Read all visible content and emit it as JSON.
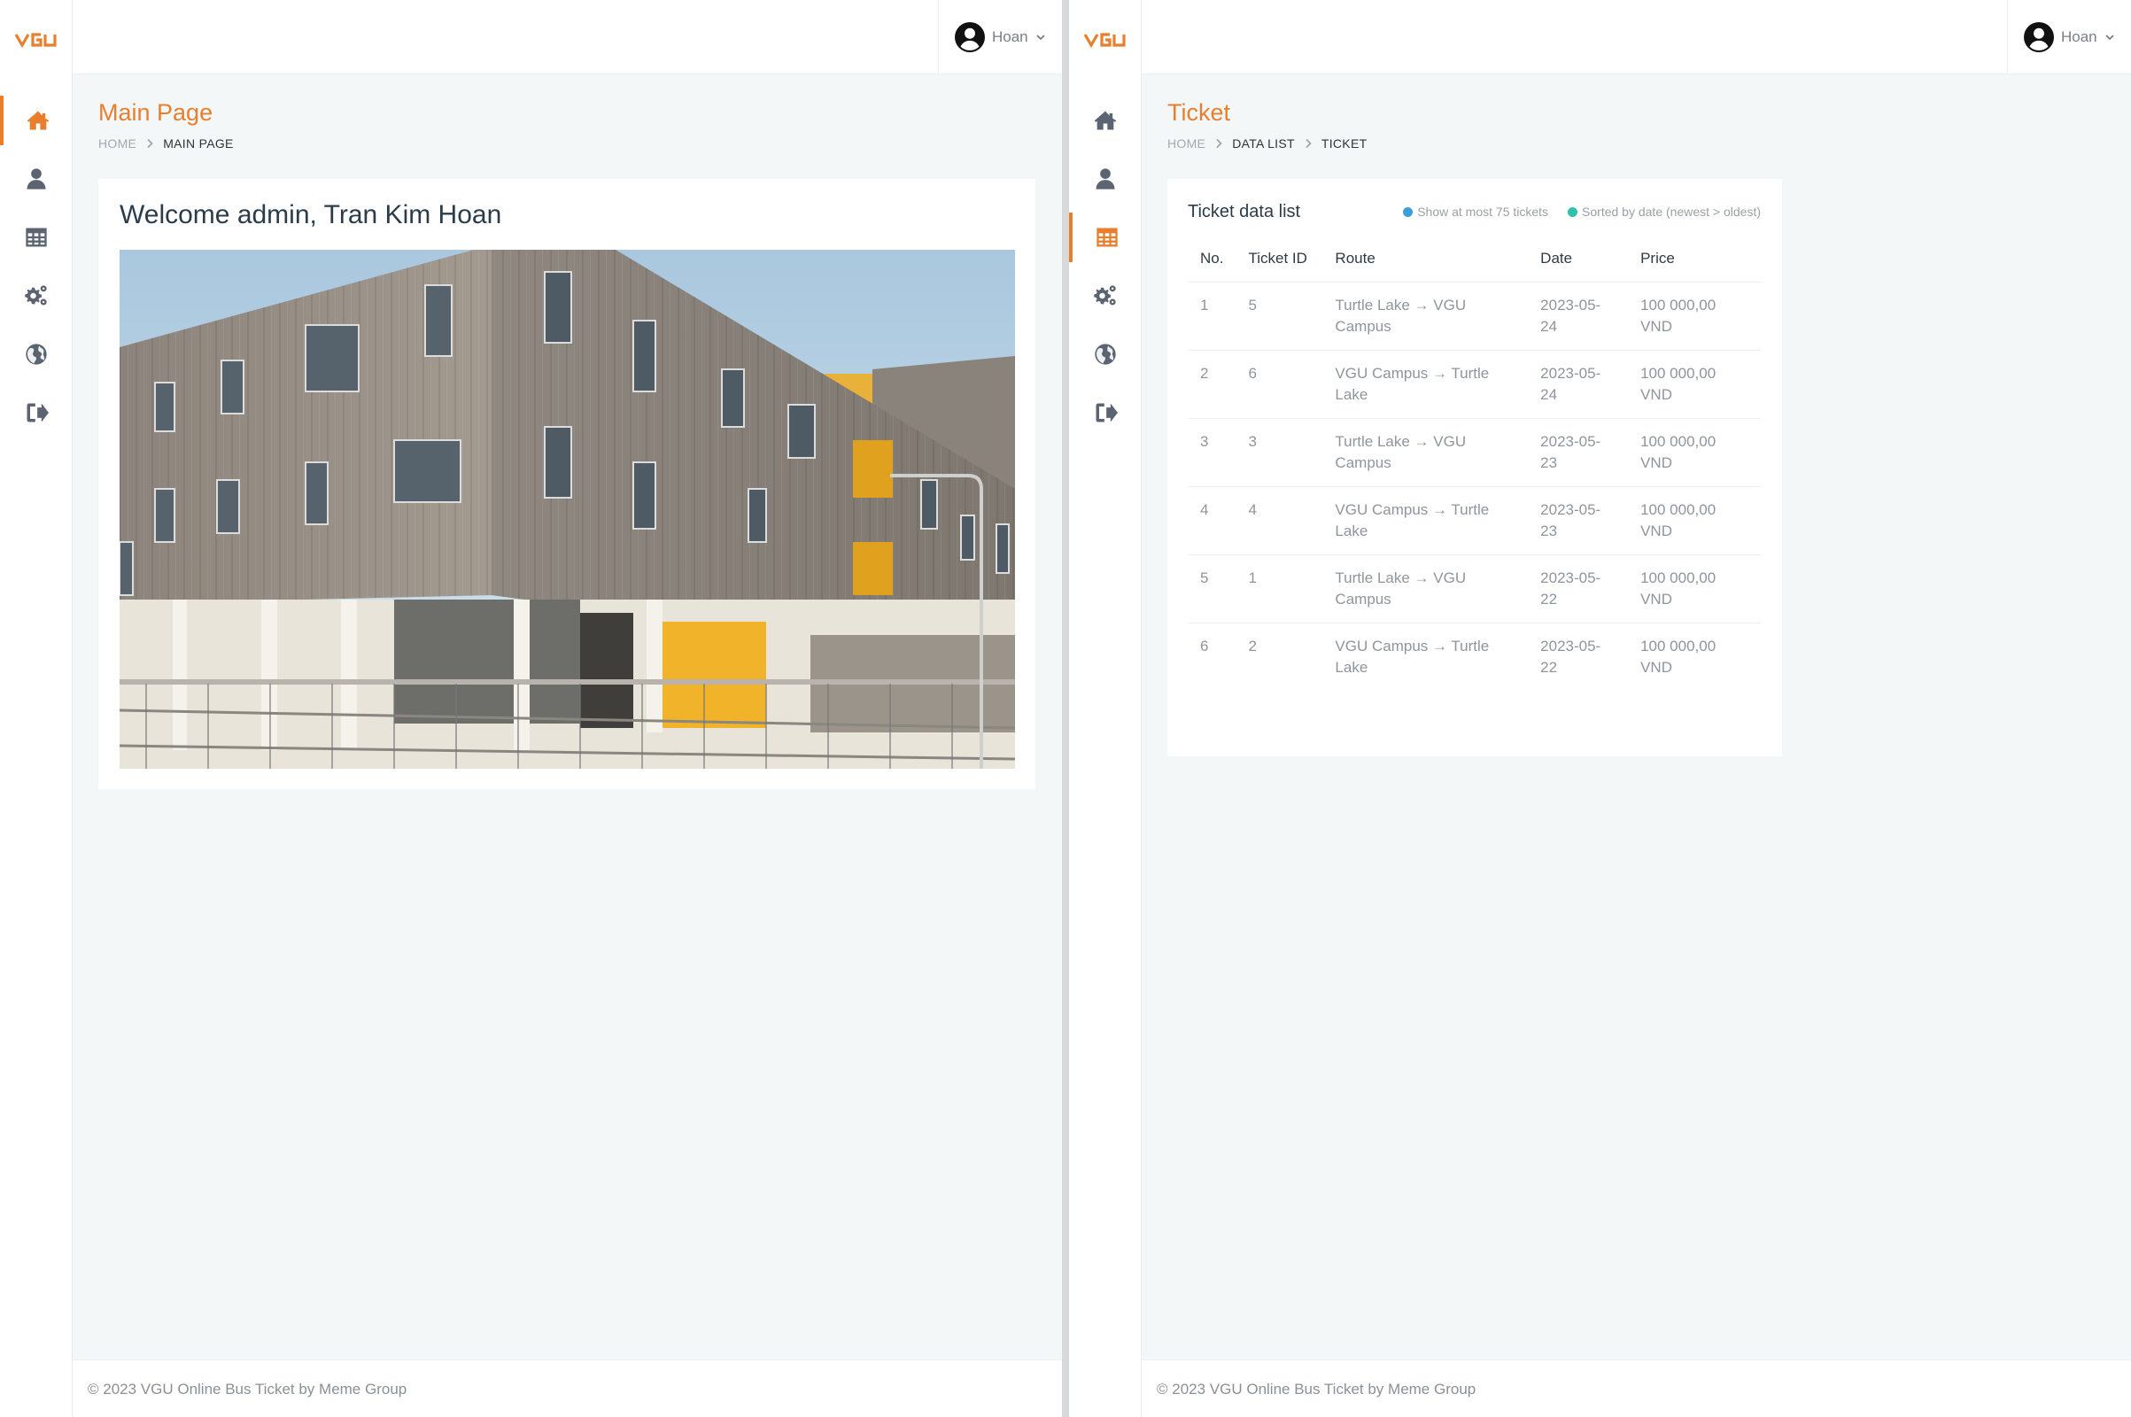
{
  "brand": {
    "logo_text": "VGU",
    "accent": "#e87f2e"
  },
  "user": {
    "name": "Hoan"
  },
  "left": {
    "page_title": "Main Page",
    "breadcrumb": [
      "HOME",
      "MAIN PAGE"
    ],
    "welcome": "Welcome admin, Tran Kim Hoan",
    "footer": "© 2023 VGU Online Bus Ticket by Meme Group",
    "nav": [
      "home-icon",
      "user-icon",
      "table-icon",
      "gears-icon",
      "globe-icon",
      "sign-out-icon"
    ],
    "active_nav": "home"
  },
  "right": {
    "page_title": "Ticket",
    "breadcrumb": [
      "HOME",
      "DATA LIST",
      "TICKET"
    ],
    "card_title": "Ticket data list",
    "legend": [
      {
        "label": "Show at most 75 tickets",
        "color": "#3d9fd9"
      },
      {
        "label": "Sorted by date (newest > oldest)",
        "color": "#2fc1a9"
      }
    ],
    "columns": {
      "no": "No.",
      "ticket_id": "Ticket ID",
      "route": "Route",
      "date": "Date",
      "price": "Price"
    },
    "rows": [
      {
        "no": "1",
        "id": "5",
        "route": "Turtle Lake → VGU Campus",
        "date": "2023-05-24",
        "price": "100 000,00 VND"
      },
      {
        "no": "2",
        "id": "6",
        "route": "VGU Campus → Turtle Lake",
        "date": "2023-05-24",
        "price": "100 000,00 VND"
      },
      {
        "no": "3",
        "id": "3",
        "route": "Turtle Lake → VGU Campus",
        "date": "2023-05-23",
        "price": "100 000,00 VND"
      },
      {
        "no": "4",
        "id": "4",
        "route": "VGU Campus → Turtle Lake",
        "date": "2023-05-23",
        "price": "100 000,00 VND"
      },
      {
        "no": "5",
        "id": "1",
        "route": "Turtle Lake → VGU Campus",
        "date": "2023-05-22",
        "price": "100 000,00 VND"
      },
      {
        "no": "6",
        "id": "2",
        "route": "VGU Campus → Turtle Lake",
        "date": "2023-05-22",
        "price": "100 000,00 VND"
      }
    ],
    "footer": "© 2023 VGU Online Bus Ticket by Meme Group",
    "active_nav": "table"
  }
}
